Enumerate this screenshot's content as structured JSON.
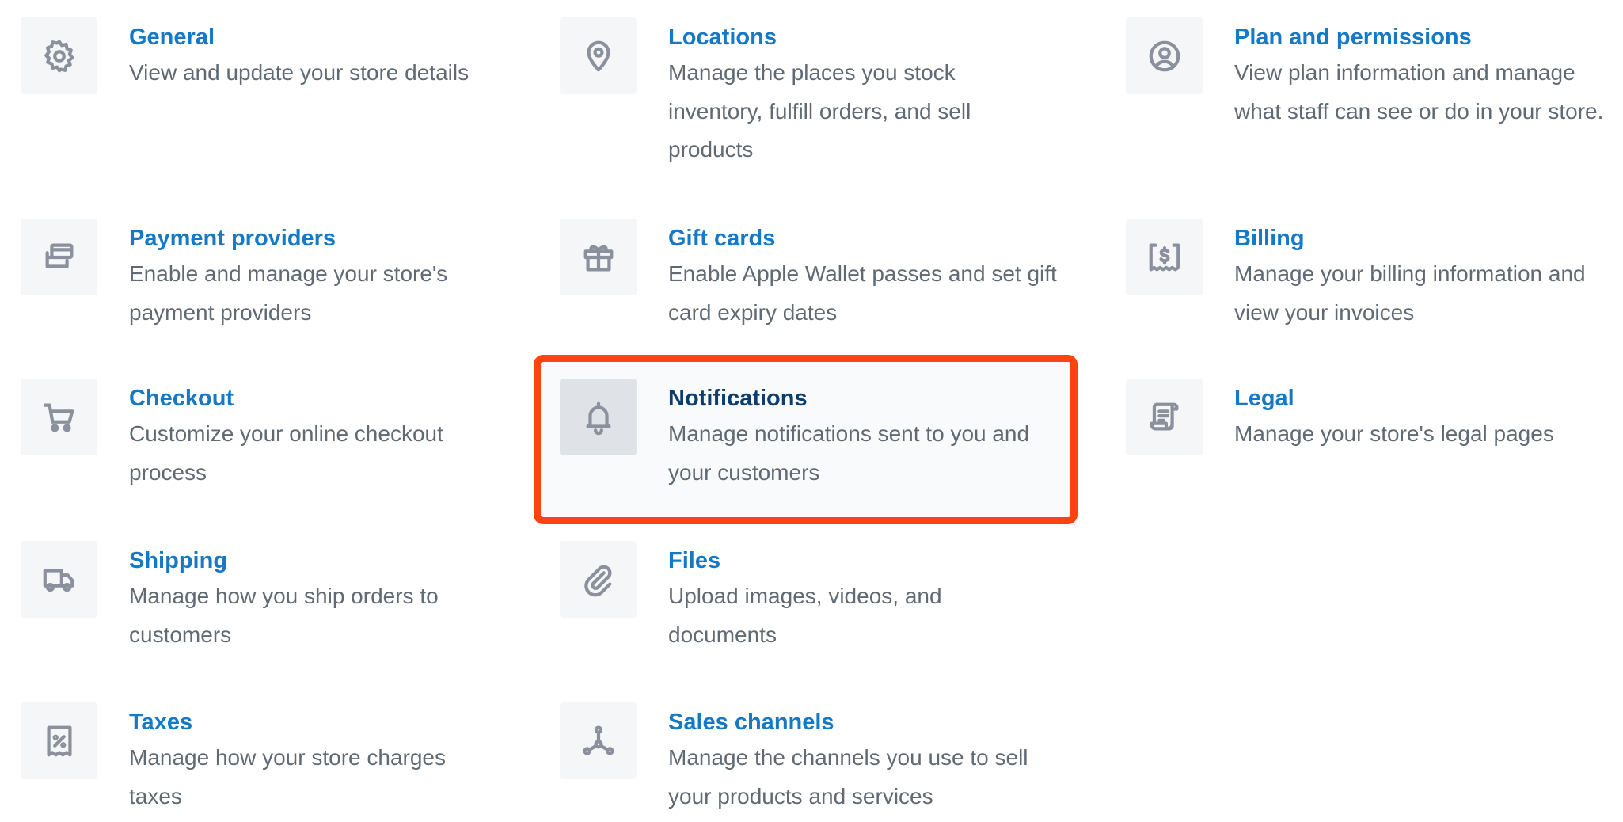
{
  "settings": {
    "general": {
      "title": "General",
      "desc": "View and update your store details",
      "icon": "gear-icon"
    },
    "locations": {
      "title": "Locations",
      "desc": "Manage the places you stock inventory, fulfill orders, and sell products",
      "icon": "map-pin-icon"
    },
    "plan": {
      "title": "Plan and permissions",
      "desc": "View plan information and manage what staff can see or do in your store.",
      "icon": "user-circle-icon"
    },
    "payment": {
      "title": "Payment providers",
      "desc": "Enable and manage your store's payment providers",
      "icon": "credit-card-icon"
    },
    "giftcards": {
      "title": "Gift cards",
      "desc": "Enable Apple Wallet passes and set gift card expiry dates",
      "icon": "gift-icon"
    },
    "billing": {
      "title": "Billing",
      "desc": "Manage your billing information and view your invoices",
      "icon": "dollar-receipt-icon"
    },
    "checkout": {
      "title": "Checkout",
      "desc": "Customize your online checkout process",
      "icon": "cart-icon"
    },
    "notifications": {
      "title": "Notifications",
      "desc": "Manage notifications sent to you and your customers",
      "icon": "bell-icon"
    },
    "legal": {
      "title": "Legal",
      "desc": "Manage your store's legal pages",
      "icon": "document-icon"
    },
    "shipping": {
      "title": "Shipping",
      "desc": "Manage how you ship orders to customers",
      "icon": "truck-icon"
    },
    "files": {
      "title": "Files",
      "desc": "Upload images, videos, and documents",
      "icon": "paperclip-icon"
    },
    "taxes": {
      "title": "Taxes",
      "desc": "Manage how your store charges taxes",
      "icon": "percent-receipt-icon"
    },
    "channels": {
      "title": "Sales channels",
      "desc": "Manage the channels you use to sell your products and services",
      "icon": "channels-icon"
    }
  },
  "colors": {
    "link": "#1679c5",
    "highlight_border": "#fd4312",
    "icon": "#8a919c"
  }
}
